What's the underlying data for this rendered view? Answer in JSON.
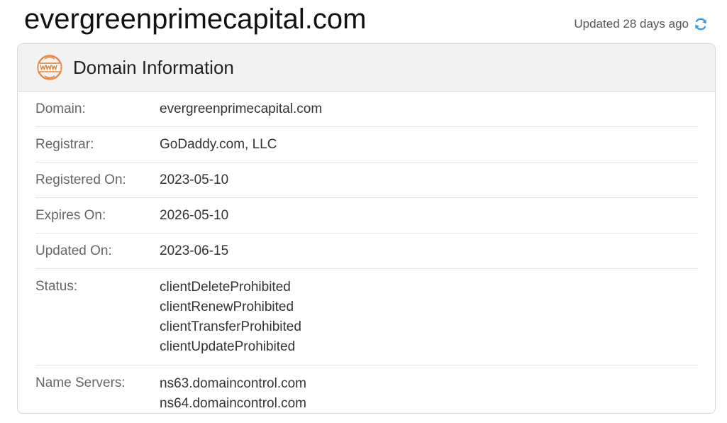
{
  "header": {
    "domain": "evergreenprimecapital.com",
    "updated_text": "Updated 28 days ago",
    "refresh_icon": "refresh-icon"
  },
  "card": {
    "icon": "www-icon",
    "title": "Domain Information",
    "rows": [
      {
        "label": "Domain:",
        "values": [
          "evergreenprimecapital.com"
        ]
      },
      {
        "label": "Registrar:",
        "values": [
          "GoDaddy.com, LLC"
        ]
      },
      {
        "label": "Registered On:",
        "values": [
          "2023-05-10"
        ]
      },
      {
        "label": "Expires On:",
        "values": [
          "2026-05-10"
        ]
      },
      {
        "label": "Updated On:",
        "values": [
          "2023-06-15"
        ]
      },
      {
        "label": "Status:",
        "values": [
          "clientDeleteProhibited",
          "clientRenewProhibited",
          "clientTransferProhibited",
          "clientUpdateProhibited"
        ]
      },
      {
        "label": "Name Servers:",
        "values": [
          "ns63.domaincontrol.com",
          "ns64.domaincontrol.com"
        ]
      }
    ]
  },
  "colors": {
    "accent_orange": "#e8833a",
    "refresh_blue": "#3b9de0",
    "header_bg": "#f2f2f2",
    "border": "#d9d9d9"
  }
}
